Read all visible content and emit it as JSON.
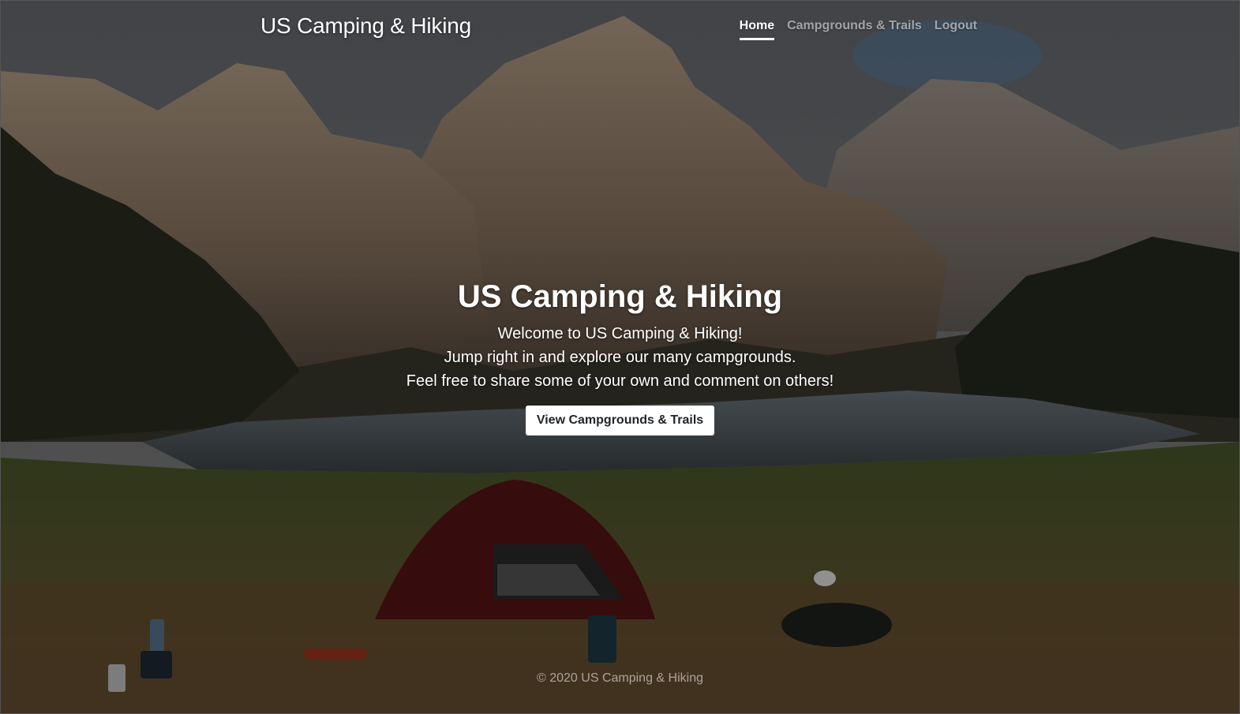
{
  "header": {
    "brand": "US Camping & Hiking",
    "nav": [
      {
        "label": "Home",
        "active": true
      },
      {
        "label": "Campgrounds & Trails",
        "active": false
      },
      {
        "label": "Logout",
        "active": false
      }
    ]
  },
  "hero": {
    "title": "US Camping & Hiking",
    "lines": [
      "Welcome to US Camping & Hiking!",
      "Jump right in and explore our many campgrounds.",
      "Feel free to share some of your own and comment on others!"
    ],
    "cta_label": "View Campgrounds & Trails"
  },
  "footer": {
    "text": "© 2020 US Camping & Hiking"
  },
  "colors": {
    "text": "#ffffff",
    "muted_text": "rgba(255,255,255,0.55)",
    "button_bg": "#ffffff",
    "button_text": "#212529"
  },
  "background": {
    "description_icon": "mountain-lake-campsite-photo"
  }
}
